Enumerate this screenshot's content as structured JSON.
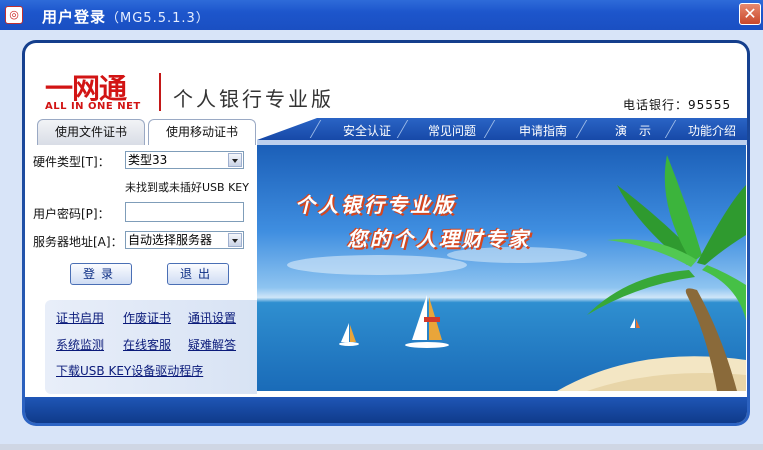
{
  "window": {
    "title": "用户登录",
    "version": "（MG5.5.1.3）",
    "close_glyph": "✕"
  },
  "header": {
    "logo_cn": "一网通",
    "logo_en": "ALL IN ONE NET",
    "product_title": "个人银行专业版",
    "phone": "电话银行：95555"
  },
  "tabs": [
    {
      "label": "使用文件证书"
    },
    {
      "label": "使用移动证书"
    }
  ],
  "nav": [
    {
      "label": "安全认证"
    },
    {
      "label": "常见问题"
    },
    {
      "label": "申请指南"
    },
    {
      "label": "演　示"
    },
    {
      "label": "功能介绍"
    }
  ],
  "login": {
    "hardware_type_label": "硬件类型[T]：",
    "hardware_type_value": "类型33",
    "hint": "未找到或未插好USB KEY",
    "password_label": "用户密码[P]：",
    "password_value": "",
    "server_label": "服务器地址[A]：",
    "server_value": "自动选择服务器",
    "login_button": "登录",
    "exit_button": "退出"
  },
  "links": [
    {
      "label": "证书启用"
    },
    {
      "label": "作废证书"
    },
    {
      "label": "通讯设置"
    },
    {
      "label": "系统监测"
    },
    {
      "label": "在线客服"
    },
    {
      "label": "疑难解答"
    },
    {
      "label": "下载USB KEY设备驱动程序"
    }
  ],
  "banner": {
    "line1": "个人银行专业版",
    "line2": "您的个人理财专家"
  },
  "colors": {
    "brand_red": "#d21414",
    "nav_blue": "#1749a8",
    "title_bar": "#1d56cc"
  }
}
